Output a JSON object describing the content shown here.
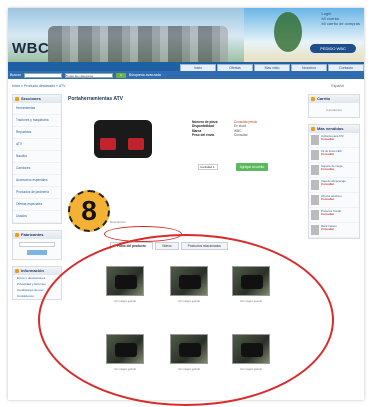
{
  "header": {
    "logo": "WBC",
    "top_links": [
      "Login",
      "Mi cuenta",
      "Mi carrito de compras"
    ],
    "phone": "PEDIDO WBC",
    "nav_tabs": [
      "Inicio",
      "Ofertas",
      "Mas visto",
      "Nosotros",
      "Contacto"
    ],
    "search_label": "Buscar",
    "category_select": "Todas las categorias",
    "search_go": "Ir",
    "advanced": "Búsqueda avanzada",
    "breadcrumb": "Inicio » Producto destacado » ATV",
    "language": "Español"
  },
  "sidebar": {
    "categories_title": "Secciones",
    "categories": [
      "Herramientas",
      "Tractores y maquinaria",
      "Repuestos",
      "ATV",
      "Nautica",
      "Camiones",
      "Accesorios especiales",
      "Productos de jardinería",
      "Ofertas especiales",
      "Usados"
    ],
    "manufacturers_title": "Fabricantes",
    "info_title": "Información",
    "info_links": [
      "Envío y devoluciones",
      "Privacidad y términos",
      "Condiciones de uso",
      "Contáctenos"
    ]
  },
  "product": {
    "title": "Portaherramientas ATV",
    "rows": [
      {
        "k": "Número de pieza",
        "v": "Consultar precio"
      },
      {
        "k": "Disponibilidad",
        "v": "En stock"
      },
      {
        "k": "Marca",
        "v": "WBC"
      },
      {
        "k": "Peso del envío",
        "v": "Consultar"
      }
    ],
    "qty_label": "Cantidad 1",
    "add_to_cart": "Agregar al carrito",
    "desc_label": "Descripción"
  },
  "tabs": [
    {
      "label": "Fotos del producto",
      "active": true
    },
    {
      "label": "Videos",
      "active": false
    },
    {
      "label": "Productos relacionados",
      "active": false
    }
  ],
  "gallery_caption": "Ver imagen grande",
  "gallery_count": 6,
  "rightcol": {
    "cart_title": "Carrito",
    "cart_empty": "0 productos",
    "bestsellers_title": "Más vendidos",
    "bestsellers": [
      {
        "name": "Cubierta para ATV",
        "price": "Consultar"
      },
      {
        "name": "Kit de luces LED",
        "price": "Consultar"
      },
      {
        "name": "Soporte de carga",
        "price": "Consultar"
      },
      {
        "name": "Caja de almacenaje",
        "price": "Consultar"
      },
      {
        "name": "Winche eléctrico",
        "price": "Consultar"
      },
      {
        "name": "Protector frontal",
        "price": "Consultar"
      },
      {
        "name": "Rack trasero",
        "price": "Consultar"
      }
    ]
  },
  "annotation": {
    "step_number": "8"
  },
  "colors": {
    "accent": "#1f5fa3",
    "highlight": "#d92b2b",
    "badge": "#f4b234"
  }
}
